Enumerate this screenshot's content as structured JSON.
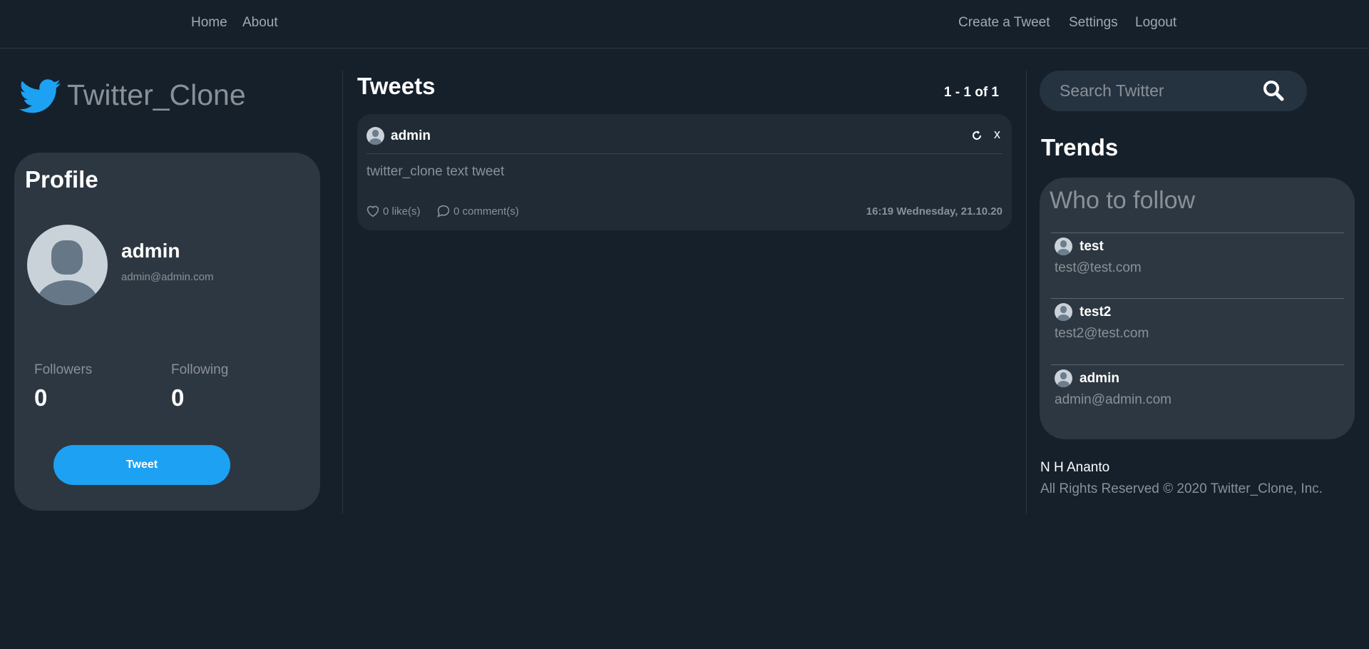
{
  "nav": {
    "home": "Home",
    "about": "About",
    "create_tweet": "Create a Tweet",
    "settings": "Settings",
    "logout": "Logout"
  },
  "brand": {
    "name": "Twitter_Clone",
    "icon": "twitter-bird-icon",
    "color": "#1da1f2"
  },
  "profile": {
    "title": "Profile",
    "name": "admin",
    "email": "admin@admin.com",
    "followers_label": "Followers",
    "followers": "0",
    "following_label": "Following",
    "following": "0",
    "tweet_button": "Tweet"
  },
  "tweets": {
    "title": "Tweets",
    "pagination": "1 - 1 of 1",
    "items": [
      {
        "author": "admin",
        "text": "twitter_clone text tweet",
        "likes": "0 like(s)",
        "comments": "0 comment(s)",
        "timestamp": "16:19 Wednesday, 21.10.20",
        "edit_icon": "refresh-icon",
        "delete_label": "x"
      }
    ]
  },
  "search": {
    "placeholder": "Search Twitter"
  },
  "trends": {
    "title": "Trends",
    "who_to_follow": "Who to follow",
    "users": [
      {
        "name": "test",
        "email": "test@test.com"
      },
      {
        "name": "test2",
        "email": "test2@test.com"
      },
      {
        "name": "admin",
        "email": "admin@admin.com"
      }
    ]
  },
  "footer": {
    "author": "N H Ananto",
    "rights": "All Rights Reserved © 2020 Twitter_Clone, Inc."
  }
}
